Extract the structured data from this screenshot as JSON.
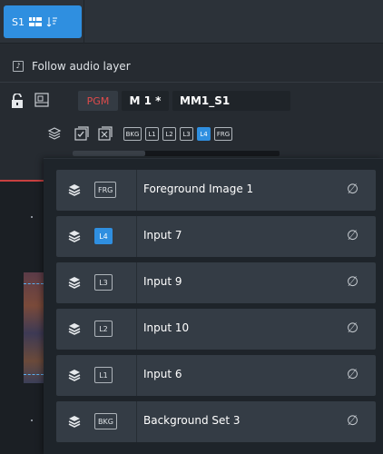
{
  "topbar": {
    "tab_label": "S1"
  },
  "follow_audio": {
    "icon": "note-icon",
    "icon_glyph": "♪",
    "label": "Follow audio layer"
  },
  "controls": {
    "pgm_label": "PGM",
    "m1_label": "M 1 *",
    "name_value": "MM1_S1",
    "pgm_color": "#e04b4b"
  },
  "layer_tags": [
    "BKG",
    "L1",
    "L2",
    "L3",
    "L4",
    "FRG"
  ],
  "active_layer": "L4",
  "layers": [
    {
      "tag": "FRG",
      "label": "Foreground Image 1",
      "active": false,
      "null_glyph": "∅"
    },
    {
      "tag": "L4",
      "label": "Input 7",
      "active": true,
      "null_glyph": "∅"
    },
    {
      "tag": "L3",
      "label": "Input 9",
      "active": false,
      "null_glyph": "∅"
    },
    {
      "tag": "L2",
      "label": "Input 10",
      "active": false,
      "null_glyph": "∅"
    },
    {
      "tag": "L1",
      "label": "Input 6",
      "active": false,
      "null_glyph": "∅"
    },
    {
      "tag": "BKG",
      "label": "Background Set 3",
      "active": false,
      "null_glyph": "∅"
    }
  ],
  "colors": {
    "accent": "#2f8fe0",
    "background": "#262b31",
    "panel": "#1e242a",
    "row": "#343c45"
  }
}
